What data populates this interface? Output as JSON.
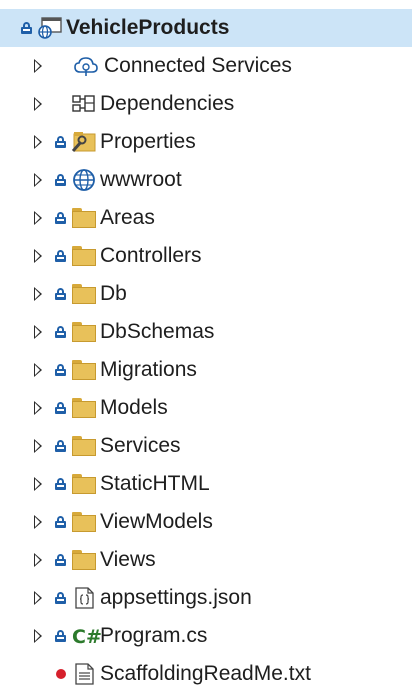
{
  "solution_explorer": {
    "root": {
      "label": "VehicleProducts",
      "icon": "web-project-icon",
      "locked": true
    },
    "items": [
      {
        "label": "Connected Services",
        "icon": "connected-services-icon",
        "expandable": true,
        "locked": false
      },
      {
        "label": "Dependencies",
        "icon": "dependencies-icon",
        "expandable": true,
        "locked": false
      },
      {
        "label": "Properties",
        "icon": "properties-folder-icon",
        "expandable": true,
        "locked": true
      },
      {
        "label": "wwwroot",
        "icon": "globe-icon",
        "expandable": true,
        "locked": true
      },
      {
        "label": "Areas",
        "icon": "folder-icon",
        "expandable": true,
        "locked": true
      },
      {
        "label": "Controllers",
        "icon": "folder-icon",
        "expandable": true,
        "locked": true
      },
      {
        "label": "Db",
        "icon": "folder-icon",
        "expandable": true,
        "locked": true
      },
      {
        "label": "DbSchemas",
        "icon": "folder-icon",
        "expandable": true,
        "locked": true
      },
      {
        "label": "Migrations",
        "icon": "folder-icon",
        "expandable": true,
        "locked": true
      },
      {
        "label": "Models",
        "icon": "folder-icon",
        "expandable": true,
        "locked": true
      },
      {
        "label": "Services",
        "icon": "folder-icon",
        "expandable": true,
        "locked": true
      },
      {
        "label": "StaticHTML",
        "icon": "folder-icon",
        "expandable": true,
        "locked": true
      },
      {
        "label": "ViewModels",
        "icon": "folder-icon",
        "expandable": true,
        "locked": true
      },
      {
        "label": "Views",
        "icon": "folder-icon",
        "expandable": true,
        "locked": true
      },
      {
        "label": "appsettings.json",
        "icon": "json-file-icon",
        "expandable": true,
        "locked": true
      },
      {
        "label": "Program.cs",
        "icon": "csharp-file-icon",
        "icon_text": "C#",
        "expandable": true,
        "locked": true
      },
      {
        "label": "ScaffoldingReadMe.txt",
        "icon": "text-file-icon",
        "expandable": false,
        "locked": false,
        "status": "red-dot"
      }
    ],
    "colors": {
      "selection": "#cce4f7",
      "lock": "#1f5fa8",
      "folder": "#e8c15a",
      "csharp": "#2c7a2c",
      "status_dot": "#d6202c"
    }
  }
}
